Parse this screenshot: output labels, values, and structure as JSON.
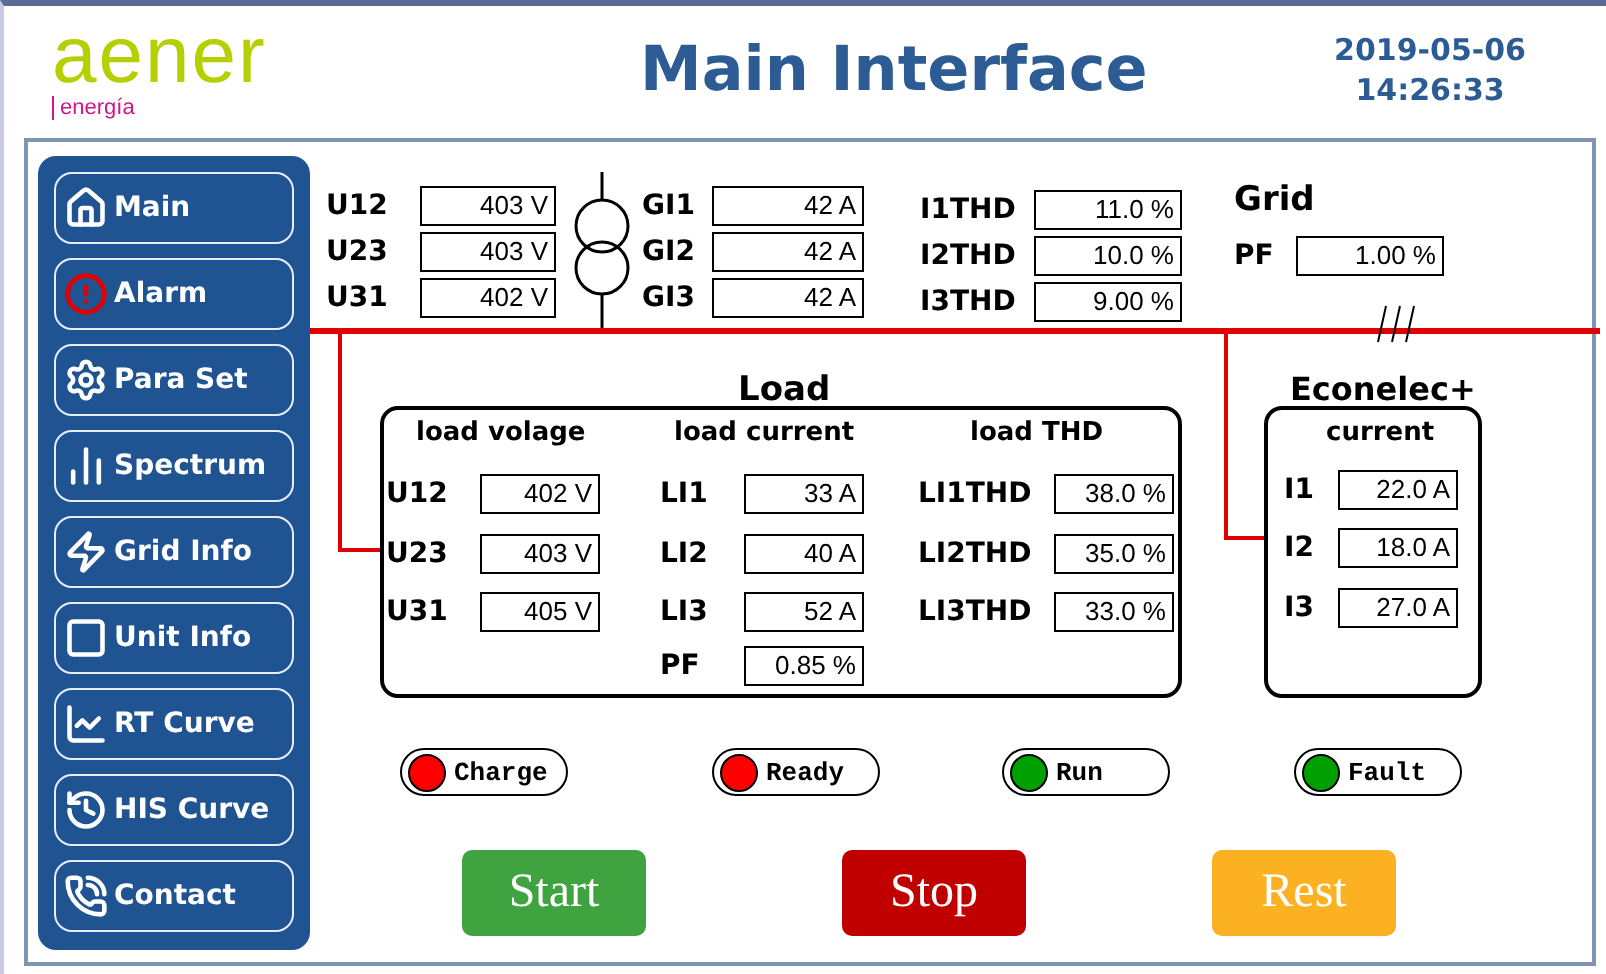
{
  "logo": {
    "brand": "aener",
    "tagline": "energía"
  },
  "title": "Main Interface",
  "datetime": {
    "date": "2019-05-06",
    "time": "14:26:33"
  },
  "nav": [
    {
      "label": "Main"
    },
    {
      "label": "Alarm"
    },
    {
      "label": "Para Set"
    },
    {
      "label": "Spectrum"
    },
    {
      "label": "Grid Info"
    },
    {
      "label": "Unit Info"
    },
    {
      "label": "RT Curve"
    },
    {
      "label": "HIS Curve"
    },
    {
      "label": "Contact"
    }
  ],
  "grid_voltage": [
    {
      "label": "U12",
      "value": "403 V"
    },
    {
      "label": "U23",
      "value": "403 V"
    },
    {
      "label": "U31",
      "value": "402 V"
    }
  ],
  "grid_current": [
    {
      "label": "GI1",
      "value": "42 A"
    },
    {
      "label": "GI2",
      "value": "42 A"
    },
    {
      "label": "GI3",
      "value": "42 A"
    }
  ],
  "grid_thd": [
    {
      "label": "I1THD",
      "value": "11.0 %"
    },
    {
      "label": "I2THD",
      "value": "10.0 %"
    },
    {
      "label": "I3THD",
      "value": "9.00 %"
    }
  ],
  "grid": {
    "title": "Grid",
    "pf_label": "PF",
    "pf_value": "1.00 %"
  },
  "load": {
    "title": "Load",
    "columns": [
      {
        "heading": "load volage",
        "rows": [
          {
            "label": "U12",
            "value": "402 V"
          },
          {
            "label": "U23",
            "value": "403 V"
          },
          {
            "label": "U31",
            "value": "405 V"
          }
        ]
      },
      {
        "heading": "load current",
        "rows": [
          {
            "label": "LI1",
            "value": "33 A"
          },
          {
            "label": "LI2",
            "value": "40 A"
          },
          {
            "label": "LI3",
            "value": "52 A"
          },
          {
            "label": "PF",
            "value": "0.85 %"
          }
        ]
      },
      {
        "heading": "load THD",
        "rows": [
          {
            "label": "LI1THD",
            "value": "38.0 %"
          },
          {
            "label": "LI2THD",
            "value": "35.0 %"
          },
          {
            "label": "LI3THD",
            "value": "33.0 %"
          }
        ]
      }
    ]
  },
  "econelec": {
    "title": "Econelec+",
    "heading": "current",
    "rows": [
      {
        "label": "I1",
        "value": "22.0 A"
      },
      {
        "label": "I2",
        "value": "18.0 A"
      },
      {
        "label": "I3",
        "value": "27.0 A"
      }
    ]
  },
  "indicators": [
    {
      "label": "Charge",
      "color": "#ff0000"
    },
    {
      "label": "Ready",
      "color": "#ff0000"
    },
    {
      "label": "Run",
      "color": "#00a000"
    },
    {
      "label": "Fault",
      "color": "#00a000"
    }
  ],
  "buttons": [
    {
      "label": "Start",
      "kind": "start"
    },
    {
      "label": "Stop",
      "kind": "stop"
    },
    {
      "label": "Rest",
      "kind": "reset"
    }
  ]
}
